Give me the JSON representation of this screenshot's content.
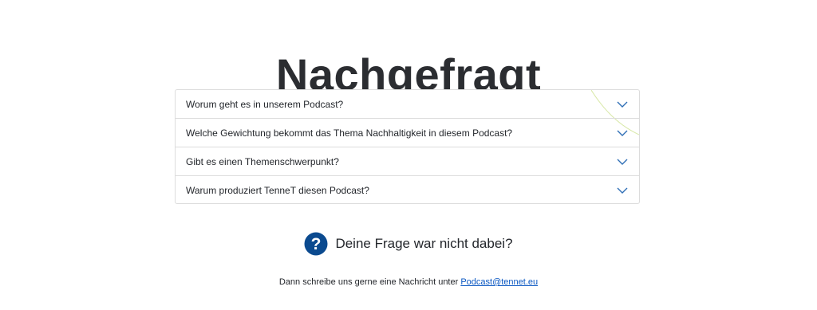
{
  "page": {
    "title": "Nachgefragt"
  },
  "faq": {
    "items": [
      {
        "question": "Worum geht es in unserem Podcast?",
        "icon": "chevron-down-icon"
      },
      {
        "question": "Welche Gewichtung bekommt das Thema Nachhaltigkeit in diesem Podcast?",
        "icon": "chevron-down-icon"
      },
      {
        "question": "Gibt es einen Themenschwerpunkt?",
        "icon": "chevron-down-icon"
      },
      {
        "question": "Warum produziert TenneT diesen Podcast?",
        "icon": "chevron-down-icon"
      }
    ]
  },
  "ask": {
    "icon": "question-icon",
    "text": "Deine Frage war nicht dabei?"
  },
  "contact": {
    "text": "Dann schreibe uns gerne eine Nachricht unter ",
    "email": "Podcast@tennet.eu",
    "email_href": "mailto:Podcast@tennet.eu"
  },
  "colors": {
    "accent": "#0a57c2",
    "icon_blue": "#0b4a8f",
    "chevron": "#2f6fb6",
    "deco_line": "#d8e8a8",
    "border": "#dcdcdc"
  }
}
